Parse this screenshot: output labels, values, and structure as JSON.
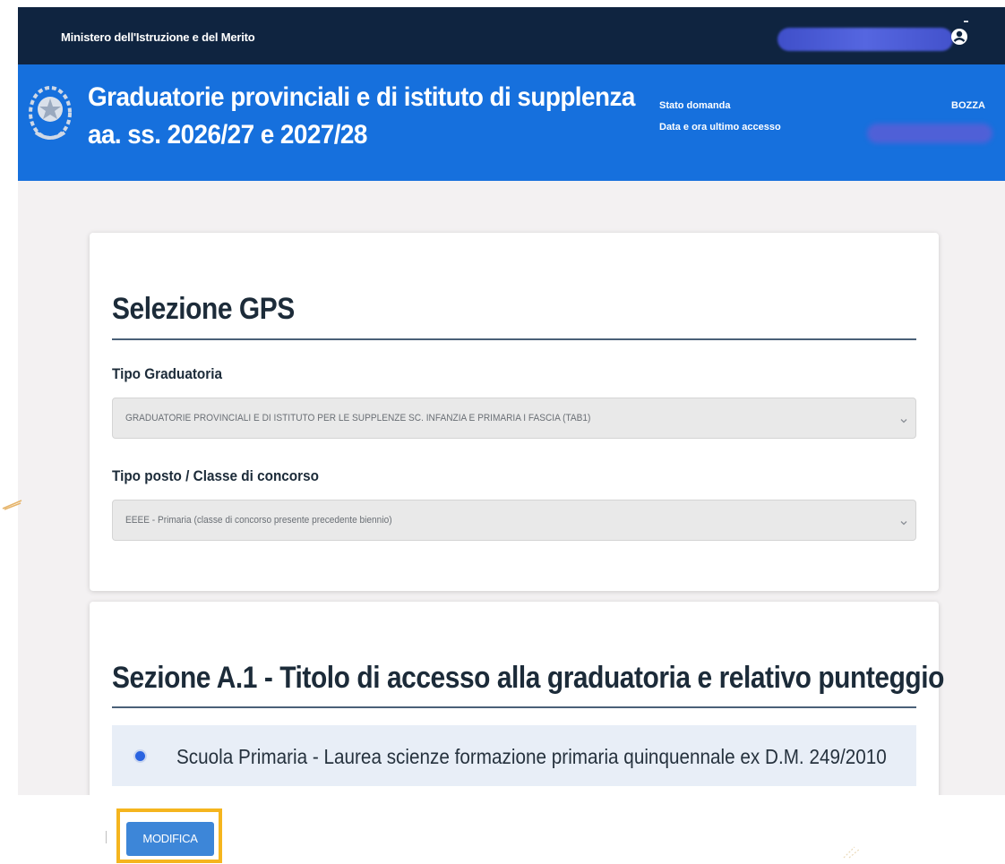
{
  "topbar": {
    "ministry": "Ministero dell'Istruzione e del Merito",
    "user_icon": "user-circle-icon"
  },
  "header": {
    "title_line1": "Graduatorie provinciali e di istituto di supplenza",
    "title_line2": "aa. ss. 2026/27 e 2027/28",
    "stato_label": "Stato domanda",
    "stato_value": "BOZZA",
    "accesso_label": "Data e ora ultimo accesso",
    "background_color": "#1670dd"
  },
  "selezione": {
    "title": "Selezione GPS",
    "tipo_graduatoria": {
      "label": "Tipo Graduatoria",
      "value": "GRADUATORIE PROVINCIALI E DI ISTITUTO PER LE SUPPLENZE SC. INFANZIA E PRIMARIA I FASCIA (TAB1)"
    },
    "tipo_posto": {
      "label": "Tipo posto / Classe di concorso",
      "value": "EEEE - Primaria (classe di concorso presente precedente biennio)"
    }
  },
  "sezione_a1": {
    "title": "Sezione A.1 - Titolo di accesso alla graduatoria e relativo punteggio",
    "option": "Scuola Primaria - Laurea scienze formazione primaria quinquennale ex D.M. 249/2010"
  },
  "actions": {
    "modifica": "MODIFICA",
    "highlight_color": "#f5b51e"
  }
}
